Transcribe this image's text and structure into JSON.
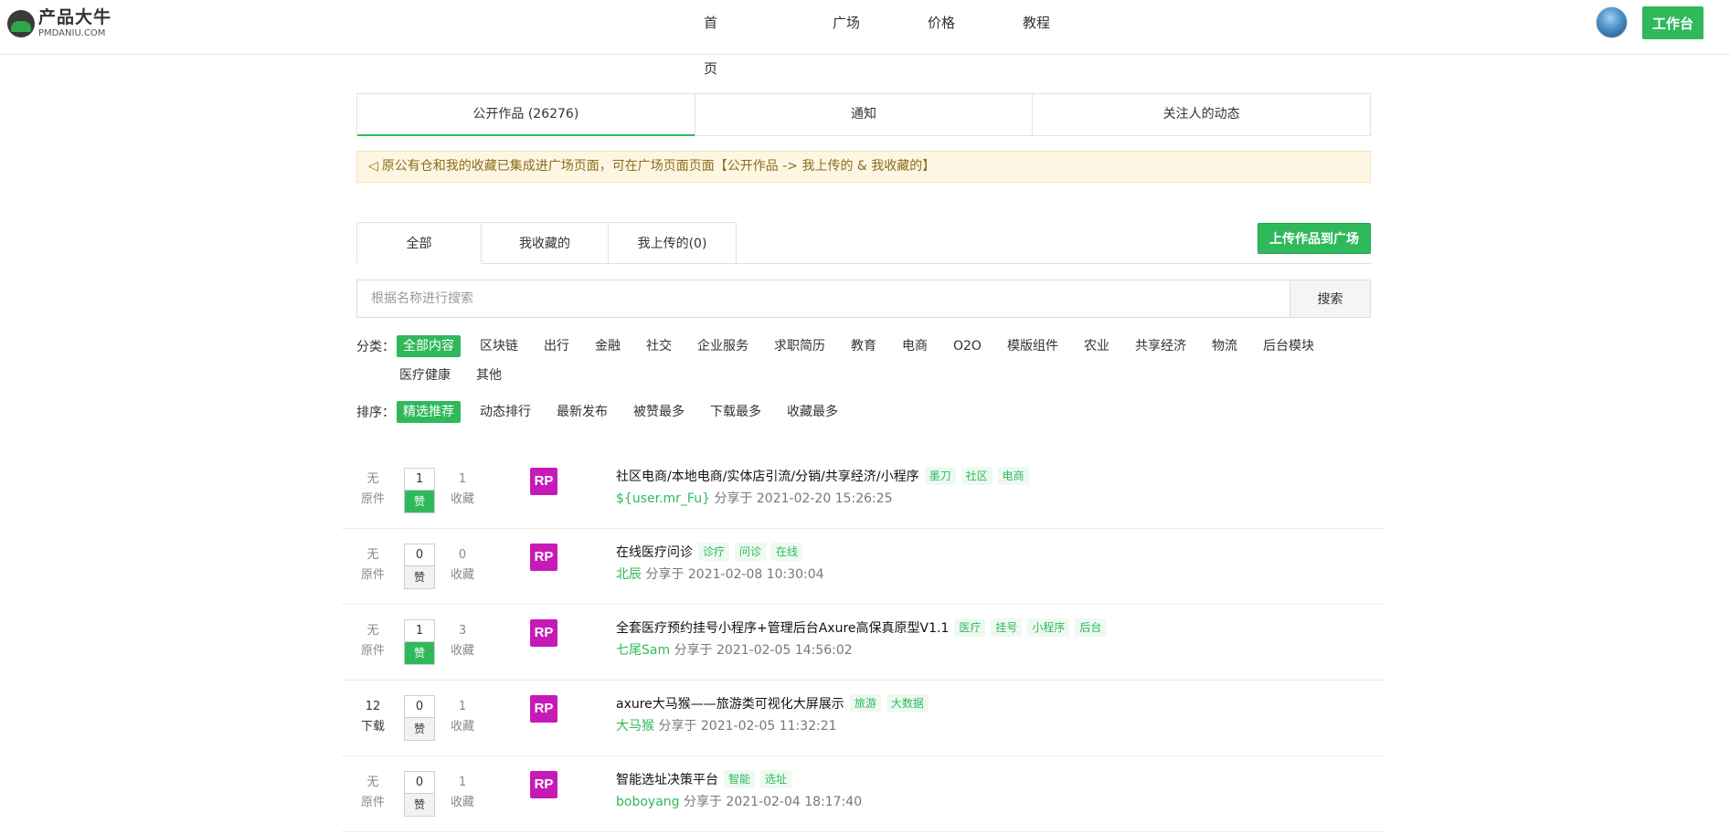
{
  "header": {
    "logo_title": "产品大牛",
    "logo_sub": "PMDANIU.COM",
    "nav": [
      "首页",
      "广场",
      "价格",
      "教程"
    ],
    "workbench_label": "工作台"
  },
  "top_tabs": [
    "公开作品 (26276)",
    "通知",
    "关注人的动态"
  ],
  "notice": {
    "icon": "◁",
    "text": "原公有仓和我的收藏已集成进广场页面，可在广场页面页面【公开作品 -> 我上传的 & 我收藏的】"
  },
  "sub_tabs": [
    "全部",
    "我收藏的",
    "我上传的(0)"
  ],
  "upload_label": "上传作品到广场",
  "search": {
    "placeholder": "根据名称进行搜索",
    "button": "搜索"
  },
  "category": {
    "label": "分类：",
    "row1": [
      "全部内容",
      "区块链",
      "出行",
      "金融",
      "社交",
      "企业服务",
      "求职简历",
      "教育",
      "电商",
      "O2O",
      "模版组件",
      "农业",
      "共享经济",
      "物流",
      "后台模块"
    ],
    "row2": [
      "医疗健康",
      "其他"
    ]
  },
  "sort": {
    "label": "排序：",
    "options": [
      "精选推荐",
      "动态排行",
      "最新发布",
      "被赞最多",
      "下载最多",
      "收藏最多"
    ]
  },
  "list": [
    {
      "dl_value": "无",
      "dl_label": "原件",
      "likes": "1",
      "like_label": "赞",
      "liked": true,
      "favs": "1",
      "fav_label": "收藏",
      "badge": "RP",
      "title": "社区电商/本地电商/实体店引流/分销/共享经济/小程序",
      "tags": [
        "墨刀",
        "社区",
        "电商"
      ],
      "author": "${user.mr_Fu}",
      "shared": "分享于 2021-02-20 15:26:25"
    },
    {
      "dl_value": "无",
      "dl_label": "原件",
      "likes": "0",
      "like_label": "赞",
      "liked": false,
      "favs": "0",
      "fav_label": "收藏",
      "badge": "RP",
      "title": "在线医疗问诊",
      "tags": [
        "诊疗",
        "问诊",
        "在线"
      ],
      "author": "北辰",
      "shared": "分享于 2021-02-08 10:30:04"
    },
    {
      "dl_value": "无",
      "dl_label": "原件",
      "likes": "1",
      "like_label": "赞",
      "liked": true,
      "favs": "3",
      "fav_label": "收藏",
      "badge": "RP",
      "title": "全套医疗预约挂号小程序+管理后台Axure高保真原型V1.1",
      "tags": [
        "医疗",
        "挂号",
        "小程序",
        "后台"
      ],
      "author": "七尾Sam",
      "shared": "分享于 2021-02-05 14:56:02"
    },
    {
      "dl_value": "12",
      "dl_label": "下载",
      "likes": "0",
      "like_label": "赞",
      "liked": false,
      "favs": "1",
      "fav_label": "收藏",
      "badge": "RP",
      "title": "axure大马猴——旅游类可视化大屏展示",
      "tags": [
        "旅游",
        "大数据"
      ],
      "author": "大马猴",
      "shared": "分享于 2021-02-05 11:32:21"
    },
    {
      "dl_value": "无",
      "dl_label": "原件",
      "likes": "0",
      "like_label": "赞",
      "liked": false,
      "favs": "1",
      "fav_label": "收藏",
      "badge": "RP",
      "title": "智能选址决策平台",
      "tags": [
        "智能",
        "选址"
      ],
      "author": "boboyang",
      "shared": "分享于 2021-02-04 18:17:40"
    }
  ]
}
